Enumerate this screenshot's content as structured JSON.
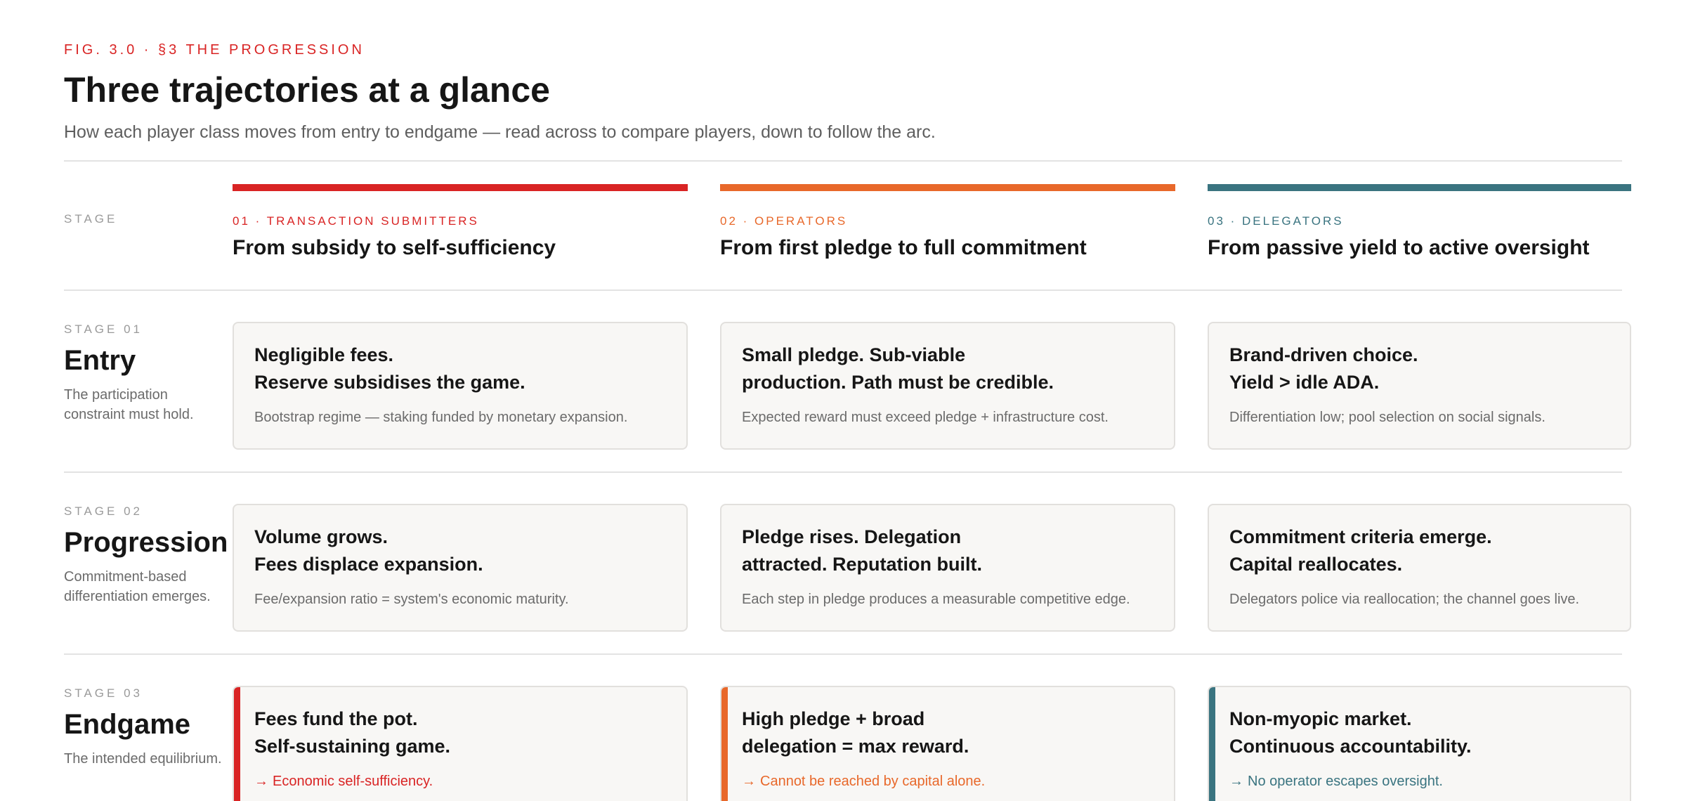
{
  "header": {
    "eyebrow": "FIG. 3.0 · §3 THE PROGRESSION",
    "title": "Three trajectories at a glance",
    "subtitle": "How each player class moves from entry to endgame — read across to compare players, down to follow the arc."
  },
  "stage_column_label": "STAGE",
  "players": [
    {
      "kicker": "01 · TRANSACTION SUBMITTERS",
      "title": "From subsidy to self-sufficiency",
      "color": "#d92424"
    },
    {
      "kicker": "02 · OPERATORS",
      "title": "From first pledge to full commitment",
      "color": "#e8682a"
    },
    {
      "kicker": "03 · DELEGATORS",
      "title": "From passive yield to active oversight",
      "color": "#3a7480"
    }
  ],
  "stages": [
    {
      "num": "STAGE 01",
      "name": "Entry",
      "desc": "The participation constraint must hold.",
      "cells": [
        {
          "head": "Negligible fees.\nReserve subsidises the game.",
          "note": "Bootstrap regime — staking funded by monetary expansion."
        },
        {
          "head": "Small pledge. Sub-viable\nproduction. Path must be credible.",
          "note": "Expected reward must exceed pledge + infrastructure cost."
        },
        {
          "head": "Brand-driven choice.\nYield > idle ADA.",
          "note": "Differentiation low; pool selection on social signals."
        }
      ]
    },
    {
      "num": "STAGE 02",
      "name": "Progression",
      "desc": "Commitment-based differentiation emerges.",
      "cells": [
        {
          "head": "Volume grows.\nFees displace expansion.",
          "note": "Fee/expansion ratio = system's economic maturity."
        },
        {
          "head": "Pledge rises. Delegation\nattracted. Reputation built.",
          "note": "Each step in pledge produces a measurable competitive edge."
        },
        {
          "head": "Commitment criteria emerge.\nCapital reallocates.",
          "note": "Delegators police via reallocation; the channel goes live."
        }
      ]
    },
    {
      "num": "STAGE 03",
      "name": "Endgame",
      "desc": "The intended equilibrium.",
      "cells": [
        {
          "head": "Fees fund the pot.\nSelf-sustaining game.",
          "note": "Economic self-sufficiency."
        },
        {
          "head": "High pledge + broad\ndelegation = max reward.",
          "note": "Cannot be reached by capital alone."
        },
        {
          "head": "Non-myopic market.\nContinuous accountability.",
          "note": "No operator escapes oversight."
        }
      ]
    }
  ],
  "endgame_arrow": "→"
}
